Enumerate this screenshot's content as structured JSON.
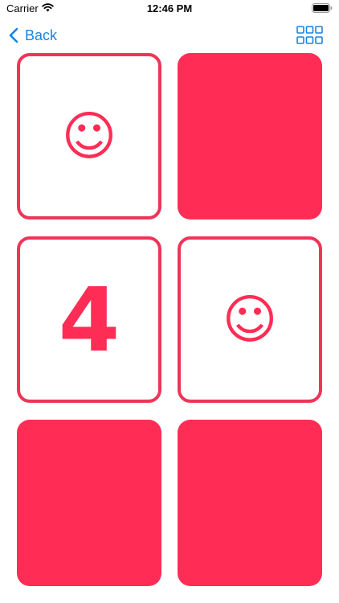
{
  "status_bar": {
    "carrier": "Carrier",
    "time": "12:46 PM",
    "wifi_icon": "wifi-icon",
    "battery_icon": "battery-full-icon"
  },
  "nav_bar": {
    "back_label": "Back",
    "back_icon": "chevron-left-icon",
    "grid_icon": "grid-icon"
  },
  "colors": {
    "accent": "#ff2d55",
    "card_border": "#ee3558",
    "nav_tint": "#1a83e0"
  },
  "cards": [
    {
      "state": "face-up",
      "symbol": "☺",
      "symbol_type": "smiley"
    },
    {
      "state": "face-down",
      "symbol": "",
      "symbol_type": ""
    },
    {
      "state": "face-up",
      "symbol": "4",
      "symbol_type": "number"
    },
    {
      "state": "face-up",
      "symbol": "☺",
      "symbol_type": "smiley"
    },
    {
      "state": "face-down",
      "symbol": "",
      "symbol_type": ""
    },
    {
      "state": "face-down",
      "symbol": "",
      "symbol_type": ""
    }
  ]
}
